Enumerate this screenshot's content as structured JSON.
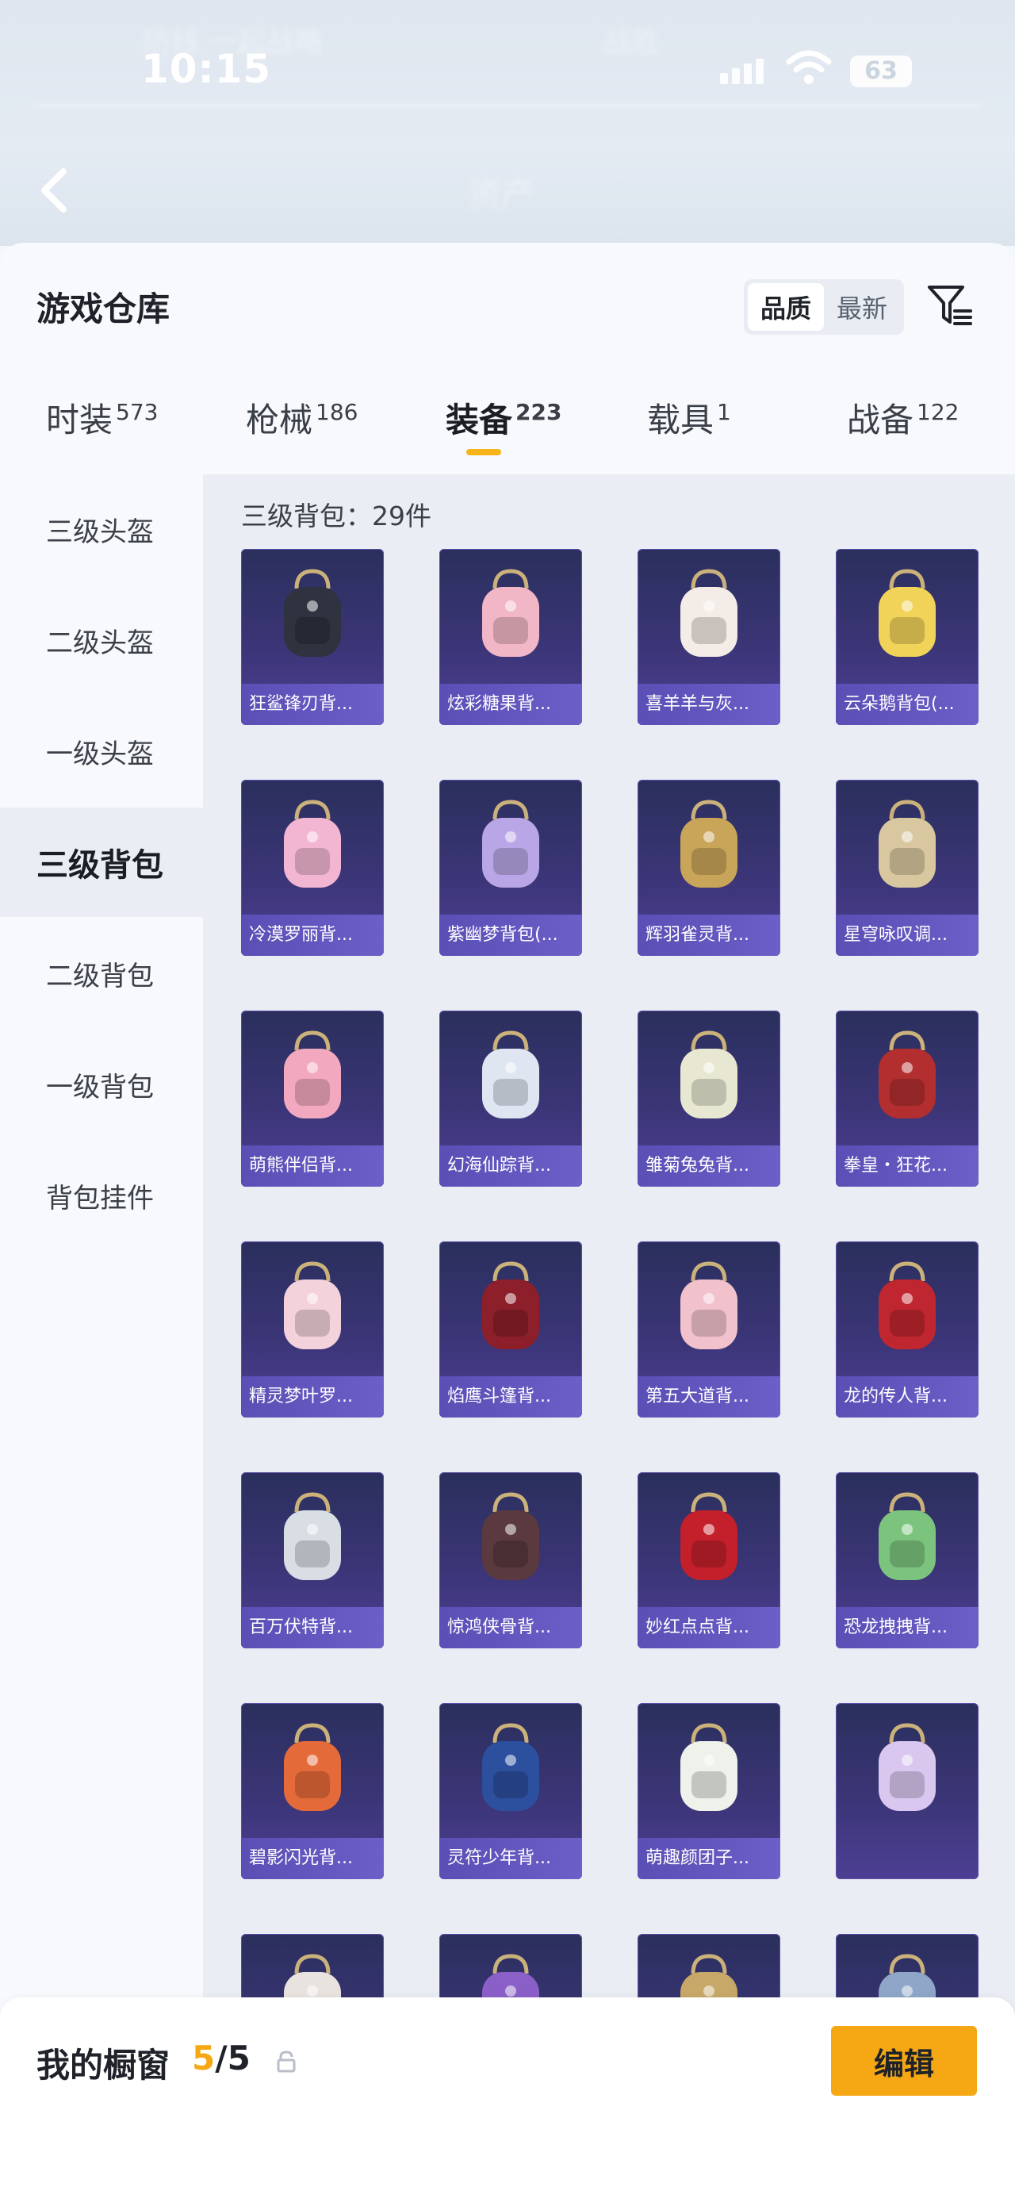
{
  "status": {
    "time": "10:15",
    "battery": "63",
    "blurred_top_left": "防线 一起战略",
    "blurred_top_right": "战胜",
    "blurred_title": "资产"
  },
  "warehouse": {
    "title": "游戏仓库",
    "sort_options": [
      "品质",
      "最新"
    ],
    "sort_active": "品质"
  },
  "tabs": [
    {
      "label": "时装",
      "count": "573"
    },
    {
      "label": "枪械",
      "count": "186"
    },
    {
      "label": "装备",
      "count": "223"
    },
    {
      "label": "载具",
      "count": "1"
    },
    {
      "label": "战备",
      "count": "122"
    }
  ],
  "sidenav": {
    "items": [
      "三级头盔",
      "二级头盔",
      "一级头盔",
      "三级背包",
      "二级背包",
      "一级背包",
      "背包挂件"
    ],
    "active": "三级背包"
  },
  "content": {
    "count_label": "三级背包：29件",
    "items": [
      {
        "name": "狂鲨锋刃背...",
        "color": "#2f3340"
      },
      {
        "name": "炫彩糖果背...",
        "color": "#f2b7c7"
      },
      {
        "name": "喜羊羊与灰...",
        "color": "#f4ece6"
      },
      {
        "name": "云朵鹅背包(...",
        "color": "#f2d35a"
      },
      {
        "name": "冷漠罗丽背...",
        "color": "#f3b6d2"
      },
      {
        "name": "紫幽梦背包(...",
        "color": "#b9a6e6"
      },
      {
        "name": "辉羽雀灵背...",
        "color": "#c9a55a"
      },
      {
        "name": "星穹咏叹调...",
        "color": "#d9c7a0"
      },
      {
        "name": "萌熊伴侣背...",
        "color": "#f2a9bf"
      },
      {
        "name": "幻海仙踪背...",
        "color": "#dfe6f2"
      },
      {
        "name": "雏菊兔兔背...",
        "color": "#e8e8d2"
      },
      {
        "name": "拳皇・狂花...",
        "color": "#b32e2e"
      },
      {
        "name": "精灵梦叶罗...",
        "color": "#f4d2dc"
      },
      {
        "name": "焰鹰斗篷背...",
        "color": "#8c1f2a"
      },
      {
        "name": "第五大道背...",
        "color": "#f2c2cc"
      },
      {
        "name": "龙的传人背...",
        "color": "#c0262f"
      },
      {
        "name": "百万伏特背...",
        "color": "#d9dde4"
      },
      {
        "name": "惊鸿侠骨背...",
        "color": "#5a3a3e"
      },
      {
        "name": "妙红点点背...",
        "color": "#c3202b"
      },
      {
        "name": "恐龙拽拽背...",
        "color": "#7cc47e"
      },
      {
        "name": "碧影闪光背...",
        "color": "#e46a3a"
      },
      {
        "name": "灵符少年背...",
        "color": "#2c4f9e"
      },
      {
        "name": "萌趣颜团子...",
        "color": "#eef2ea"
      },
      {
        "name": "",
        "color": "#d9c7ef"
      },
      {
        "name": "",
        "color": "#e9e3e0"
      },
      {
        "name": "",
        "color": "#8b5fc8"
      },
      {
        "name": "",
        "color": "#c7a868"
      },
      {
        "name": "",
        "color": "#8fa6c8"
      }
    ]
  },
  "bottom": {
    "label": "我的橱窗",
    "count_current": "5",
    "count_sep": "/",
    "count_total": "5",
    "edit_label": "编辑"
  },
  "colors": {
    "accent": "#f6a814",
    "card_label": "#6b5fc8"
  }
}
